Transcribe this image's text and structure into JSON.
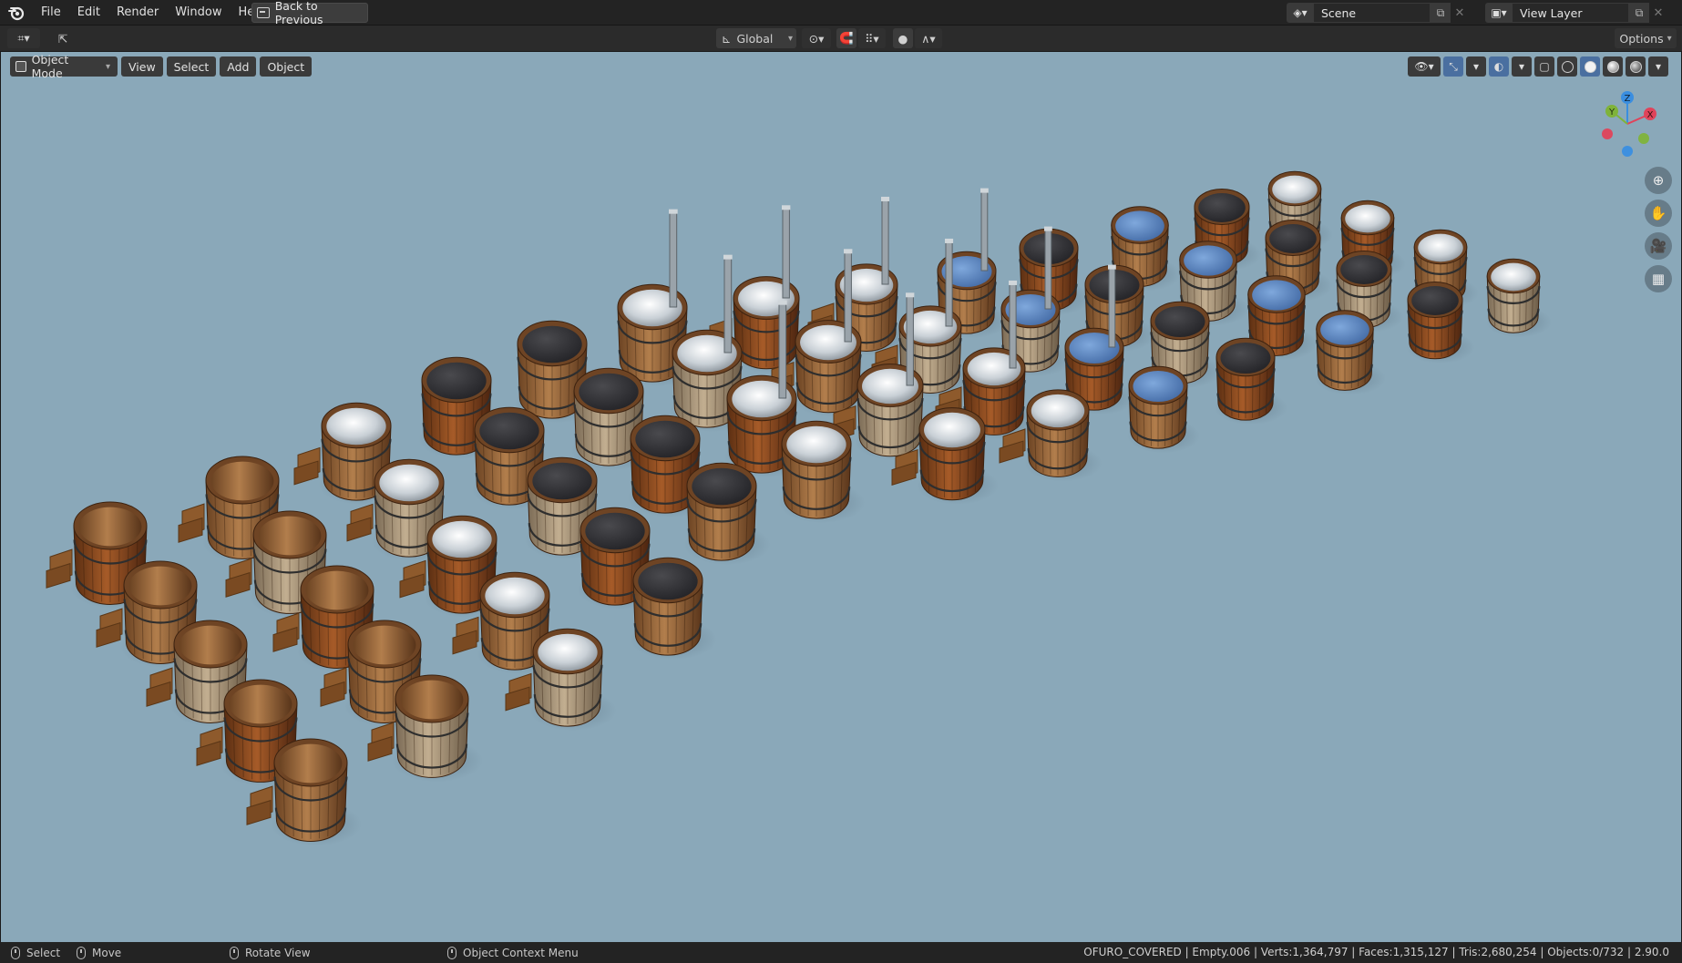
{
  "menubar": {
    "items": [
      "File",
      "Edit",
      "Render",
      "Window",
      "Help"
    ],
    "back_button": "Back to Previous",
    "scene_label": "Scene",
    "view_layer_label": "View Layer"
  },
  "tool_header": {
    "transform_orientation": "Global",
    "options_label": "Options"
  },
  "viewport_header": {
    "mode": "Object Mode",
    "menus": [
      "View",
      "Select",
      "Add",
      "Object"
    ]
  },
  "gizmo": {
    "x_label": "X",
    "y_label": "Y",
    "z_label": "Z"
  },
  "statusbar": {
    "select_label": "Select",
    "move_label": "Move",
    "rotate_label": "Rotate View",
    "context_label": "Object Context Menu",
    "stats": "OFURO_COVERED | Empty.006 | Verts:1,364,797 | Faces:1,315,127 | Tris:2,680,254 | Objects:0/732 | 2.90.0"
  },
  "colors": {
    "viewport_bg": "#8aa8b9",
    "header_bg": "#2b2b2b",
    "active_blue": "#4b72a8"
  }
}
